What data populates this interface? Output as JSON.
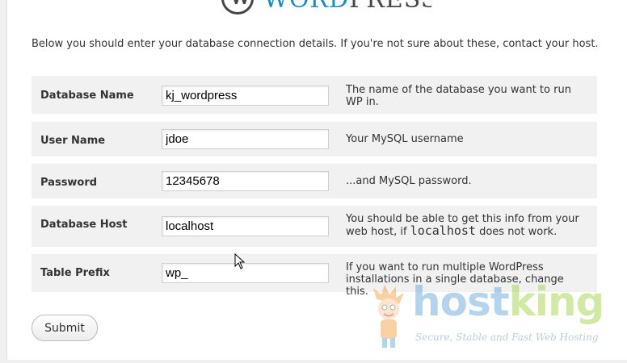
{
  "logo": {
    "word": "WORD",
    "press": "PRESS"
  },
  "intro": "Below you should enter your database connection details. If you're not sure about these, contact your host.",
  "fields": [
    {
      "label": "Database Name",
      "value": "kj_wordpress",
      "help": "The name of the database you want to run WP in."
    },
    {
      "label": "User Name",
      "value": "jdoe",
      "help": "Your MySQL username"
    },
    {
      "label": "Password",
      "value": "12345678",
      "help": "...and MySQL password."
    },
    {
      "label": "Database Host",
      "value": "localhost",
      "help_before": "You should be able to get this info from your web host, if ",
      "help_code": "localhost",
      "help_after": " does not work."
    },
    {
      "label": "Table Prefix",
      "value": "wp_",
      "help": "If you want to run multiple WordPress installations in a single database, change this."
    }
  ],
  "submit_label": "Submit",
  "watermark": {
    "host": "host",
    "king": "king",
    "tagline": "Secure, Stable and Fast Web Hosting"
  },
  "colors": {
    "row_bg": "#f1f1f1",
    "hk_blue": "#5b9fd6",
    "hk_green": "#9bcf37"
  }
}
